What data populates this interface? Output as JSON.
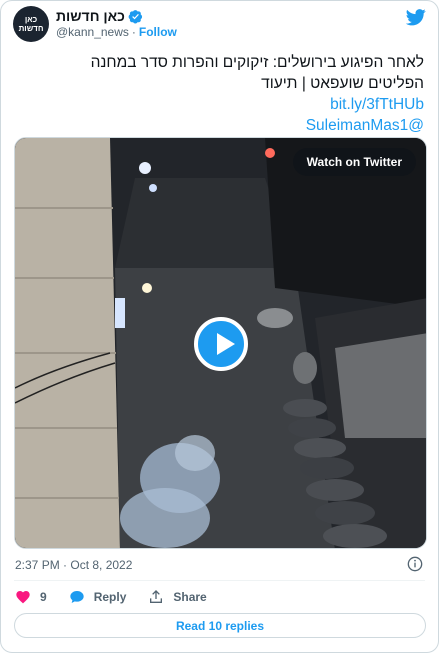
{
  "author": {
    "avatar_line1": "כאן",
    "avatar_line2": "חדשות",
    "display_name": "כאן חדשות",
    "handle": "@kann_news",
    "separator": "·",
    "follow_label": "Follow"
  },
  "tweet": {
    "line1": "לאחר הפיגוע בירושלים: זיקוקים והפרות סדר במחנה",
    "line2": "הפליטים שועפאט | תיעוד",
    "link": "bit.ly/3fTtHUb",
    "mention": "@SuleimanMas1"
  },
  "media": {
    "watch_label": "Watch on Twitter"
  },
  "meta": {
    "timestamp": "2:37 PM · Oct 8, 2022"
  },
  "actions": {
    "like_count": "9",
    "reply_label": "Reply",
    "share_label": "Share"
  },
  "read_replies_label": "Read 10 replies",
  "colors": {
    "accent": "#1d9bf0",
    "like": "#f91880",
    "text": "#0f1419",
    "muted": "#536471"
  }
}
